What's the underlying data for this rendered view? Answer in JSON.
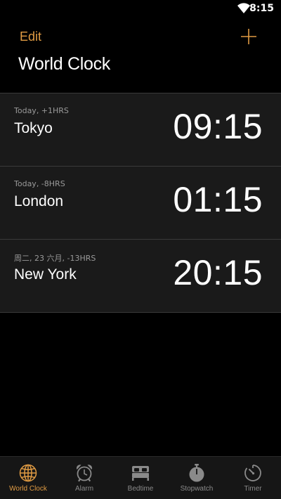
{
  "status_bar": {
    "time": "8:15",
    "wifi_icon": "wifi-icon"
  },
  "header": {
    "edit_label": "Edit",
    "add_icon": "plus-icon",
    "title": "World Clock"
  },
  "clocks": [
    {
      "offset": "Today, +1HRS",
      "city": "Tokyo",
      "time": "09:15"
    },
    {
      "offset": "Today, -8HRS",
      "city": "London",
      "time": "01:15"
    },
    {
      "offset": "周二, 23 六月, -13HRS",
      "city": "New York",
      "time": "20:15"
    }
  ],
  "tabs": [
    {
      "label": "World Clock",
      "icon": "globe-icon",
      "active": true
    },
    {
      "label": "Alarm",
      "icon": "alarm-clock-icon",
      "active": false
    },
    {
      "label": "Bedtime",
      "icon": "bed-icon",
      "active": false
    },
    {
      "label": "Stopwatch",
      "icon": "stopwatch-icon",
      "active": false
    },
    {
      "label": "Timer",
      "icon": "timer-icon",
      "active": false
    }
  ],
  "colors": {
    "accent": "#e09b43",
    "inactive": "#8a8a8a",
    "background": "#000000",
    "row_background": "#1a1a1a"
  }
}
